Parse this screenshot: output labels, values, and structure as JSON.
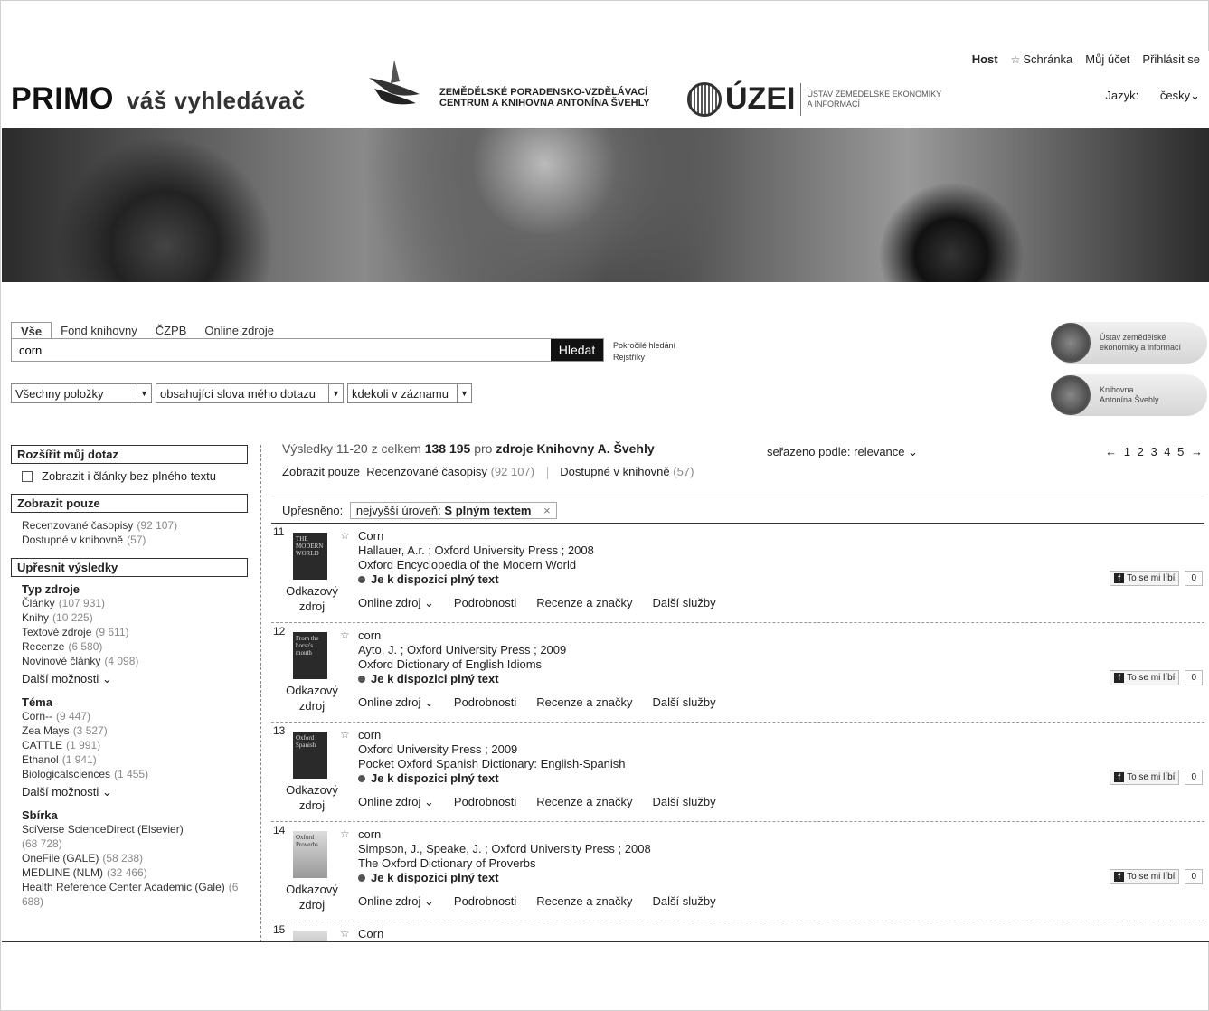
{
  "topnav": {
    "host": "Host",
    "clipboard": "Schránka",
    "account": "Můj účet",
    "login": "Přihlásit se"
  },
  "logo": {
    "primo": "PRIMO",
    "sub": "váš vyhledávač"
  },
  "kas": {
    "line1": "ZEMĚDĚLSKÉ PORADENSKO-VZDĚLÁVACÍ",
    "line2": "CENTRUM A KNIHOVNA ANTONÍNA ŠVEHLY"
  },
  "uzei": {
    "word": "ÚZEI",
    "line1": "ÚSTAV ZEMĚDĚLSKÉ EKONOMIKY",
    "line2": "A INFORMACÍ"
  },
  "lang": {
    "label": "Jazyk:",
    "value": "česky"
  },
  "search": {
    "tabs": [
      "Vše",
      "Fond knihovny",
      "ČZPB",
      "Online zdroje"
    ],
    "value": "corn",
    "button": "Hledat",
    "advanced": "Pokročilé hledání",
    "indexes": "Rejstříky",
    "filters": [
      "Všechny položky",
      "obsahující slova mého dotazu",
      "kdekoli v záznamu"
    ]
  },
  "badges": [
    {
      "line1": "Ústav zemědělské",
      "line2": "ekonomiky a informací"
    },
    {
      "line1": "Knihovna",
      "line2": "Antonína Švehly"
    }
  ],
  "facets": {
    "expand_head": "Rozšířit můj dotaz",
    "expand_check": "Zobrazit i články bez plného textu",
    "show_head": "Zobrazit pouze",
    "show_items": [
      {
        "label": "Recenzované časopisy",
        "count": "(92 107)"
      },
      {
        "label": "Dostupné v knihovně",
        "count": "(57)"
      }
    ],
    "refine_head": "Upřesnit výsledky",
    "type_head": "Typ zdroje",
    "type_items": [
      {
        "label": "Články",
        "count": "(107 931)"
      },
      {
        "label": "Knihy",
        "count": "(10 225)"
      },
      {
        "label": "Textové zdroje",
        "count": "(9 611)"
      },
      {
        "label": "Recenze",
        "count": "(6 580)"
      },
      {
        "label": "Novinové články",
        "count": "(4 098)"
      }
    ],
    "more": "Další možnosti",
    "topic_head": "Téma",
    "topic_items": [
      {
        "label": "Corn--",
        "count": "(9 447)"
      },
      {
        "label": "Zea Mays",
        "count": "(3 527)"
      },
      {
        "label": "CATTLE",
        "count": "(1 991)"
      },
      {
        "label": "Ethanol",
        "count": "(1 941)"
      },
      {
        "label": "Biologicalsciences",
        "count": "(1 455)"
      }
    ],
    "collection_head": "Sbírka",
    "collection_items": [
      {
        "label": "SciVerse ScienceDirect (Elsevier)",
        "count": "(68 728)"
      },
      {
        "label": "OneFile (GALE)",
        "count": "(58 238)"
      },
      {
        "label": "MEDLINE (NLM)",
        "count": "(32 466)"
      },
      {
        "label": "Health Reference Center Academic (Gale)",
        "count": "(6 688)"
      }
    ]
  },
  "results": {
    "summary_prefix": "Výsledky 11-20 z celkem",
    "total": "138 195",
    "summary_mid": "pro",
    "scope": "zdroje Knihovny A. Švehly",
    "sort_label": "seřazeno podle:",
    "sort_value": "relevance",
    "pages": "1 2 3 4 5",
    "show_only": "Zobrazit pouze",
    "show_reviewed": "Recenzované časopisy",
    "show_reviewed_count": "(92 107)",
    "show_available": "Dostupné v knihovně",
    "show_available_count": "(57)",
    "refined_label": "Upřesněno:",
    "refined_key": "nejvyšší úroveň:",
    "refined_value": "S plným textem",
    "refined_x": "×",
    "source": "Odkazový zdroj",
    "fulltext": "Je k dispozici plný text",
    "actions": [
      "Online zdroj",
      "Podrobnosti",
      "Recenze a značky",
      "Další služby"
    ],
    "like": "To se mi líbí",
    "like_count": "0",
    "records": [
      {
        "num": "11",
        "title": "Corn",
        "authors": "Hallauer, A.r. ; Oxford University Press ; 2008",
        "work": "Oxford Encyclopedia of the Modern World",
        "thumb": "THE MODERN WORLD"
      },
      {
        "num": "12",
        "title": "corn",
        "authors": "Ayto, J. ; Oxford University Press ; 2009",
        "work": "Oxford Dictionary of English Idioms",
        "thumb": "From the horse's mouth"
      },
      {
        "num": "13",
        "title": "corn",
        "authors": "Oxford University Press ; 2009",
        "work": "Pocket Oxford Spanish Dictionary: English-Spanish",
        "thumb": "Oxford Spanish"
      },
      {
        "num": "14",
        "title": "corn",
        "authors": "Simpson, J., Speake, J. ; Oxford University Press ; 2008",
        "work": "The Oxford Dictionary of Proverbs",
        "thumb": "Oxford Proverbs"
      },
      {
        "num": "15",
        "title": "Corn"
      }
    ]
  }
}
